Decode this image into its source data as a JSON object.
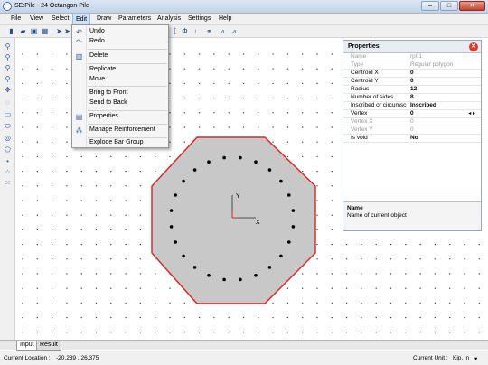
{
  "window": {
    "title": "SE:Pile - 24 Octangon Pile",
    "min": "–",
    "max": "□",
    "close": "✕"
  },
  "menubar": [
    "File",
    "View",
    "Select",
    "Edit",
    "Draw",
    "Parameters",
    "Analysis",
    "Settings",
    "Help"
  ],
  "edit_menu": [
    {
      "label": "Undo",
      "icon": "undo-icon",
      "glyph": "↶"
    },
    {
      "label": "Redo",
      "icon": "redo-icon",
      "glyph": "↷"
    },
    {
      "label": "Delete",
      "icon": "trash-icon",
      "glyph": "🗑"
    },
    {
      "label": "Replicate",
      "icon": "",
      "glyph": ""
    },
    {
      "label": "Move",
      "icon": "",
      "glyph": ""
    },
    {
      "label": "Bring to Front",
      "icon": "",
      "glyph": ""
    },
    {
      "label": "Send to Back",
      "icon": "",
      "glyph": ""
    },
    {
      "label": "Properties",
      "icon": "properties-icon",
      "glyph": "▤"
    },
    {
      "label": "Manage Reinforcement",
      "icon": "reinforcement-icon",
      "glyph": "⁂"
    },
    {
      "label": "Explode Bar Group",
      "icon": "",
      "glyph": ""
    }
  ],
  "properties": {
    "title": "Properties",
    "rows": [
      {
        "k": "Name",
        "v": "rp01",
        "disabled": true
      },
      {
        "k": "Type",
        "v": "Regular polygon",
        "disabled": true
      },
      {
        "k": "Centroid  X",
        "v": "0",
        "disabled": false
      },
      {
        "k": "Centroid  Y",
        "v": "0",
        "disabled": false
      },
      {
        "k": "Radius",
        "v": "12",
        "disabled": false
      },
      {
        "k": "Number of sides",
        "v": "8",
        "disabled": false
      },
      {
        "k": "Inscribed or circumsc",
        "v": "Inscribed",
        "disabled": false
      },
      {
        "k": "Vertex",
        "v": "0",
        "disabled": false
      },
      {
        "k": "Vertex X",
        "v": "0",
        "disabled": true
      },
      {
        "k": "Vertex Y",
        "v": "0",
        "disabled": true
      },
      {
        "k": "Is void",
        "v": "No",
        "disabled": false
      }
    ],
    "desc_title": "Name",
    "desc_text": "Name of current object"
  },
  "tabs": {
    "input": "Input",
    "result": "Result"
  },
  "status": {
    "location_label": "Current Location :",
    "location_value": "-20.239 , 26.375",
    "unit_label": "Current Unit :",
    "unit_value": "Kip, in"
  },
  "canvas": {
    "axis_x": "X",
    "axis_y": "Y",
    "polygon_fill": "#c8c8c8",
    "polygon_stroke": "#e02020"
  }
}
